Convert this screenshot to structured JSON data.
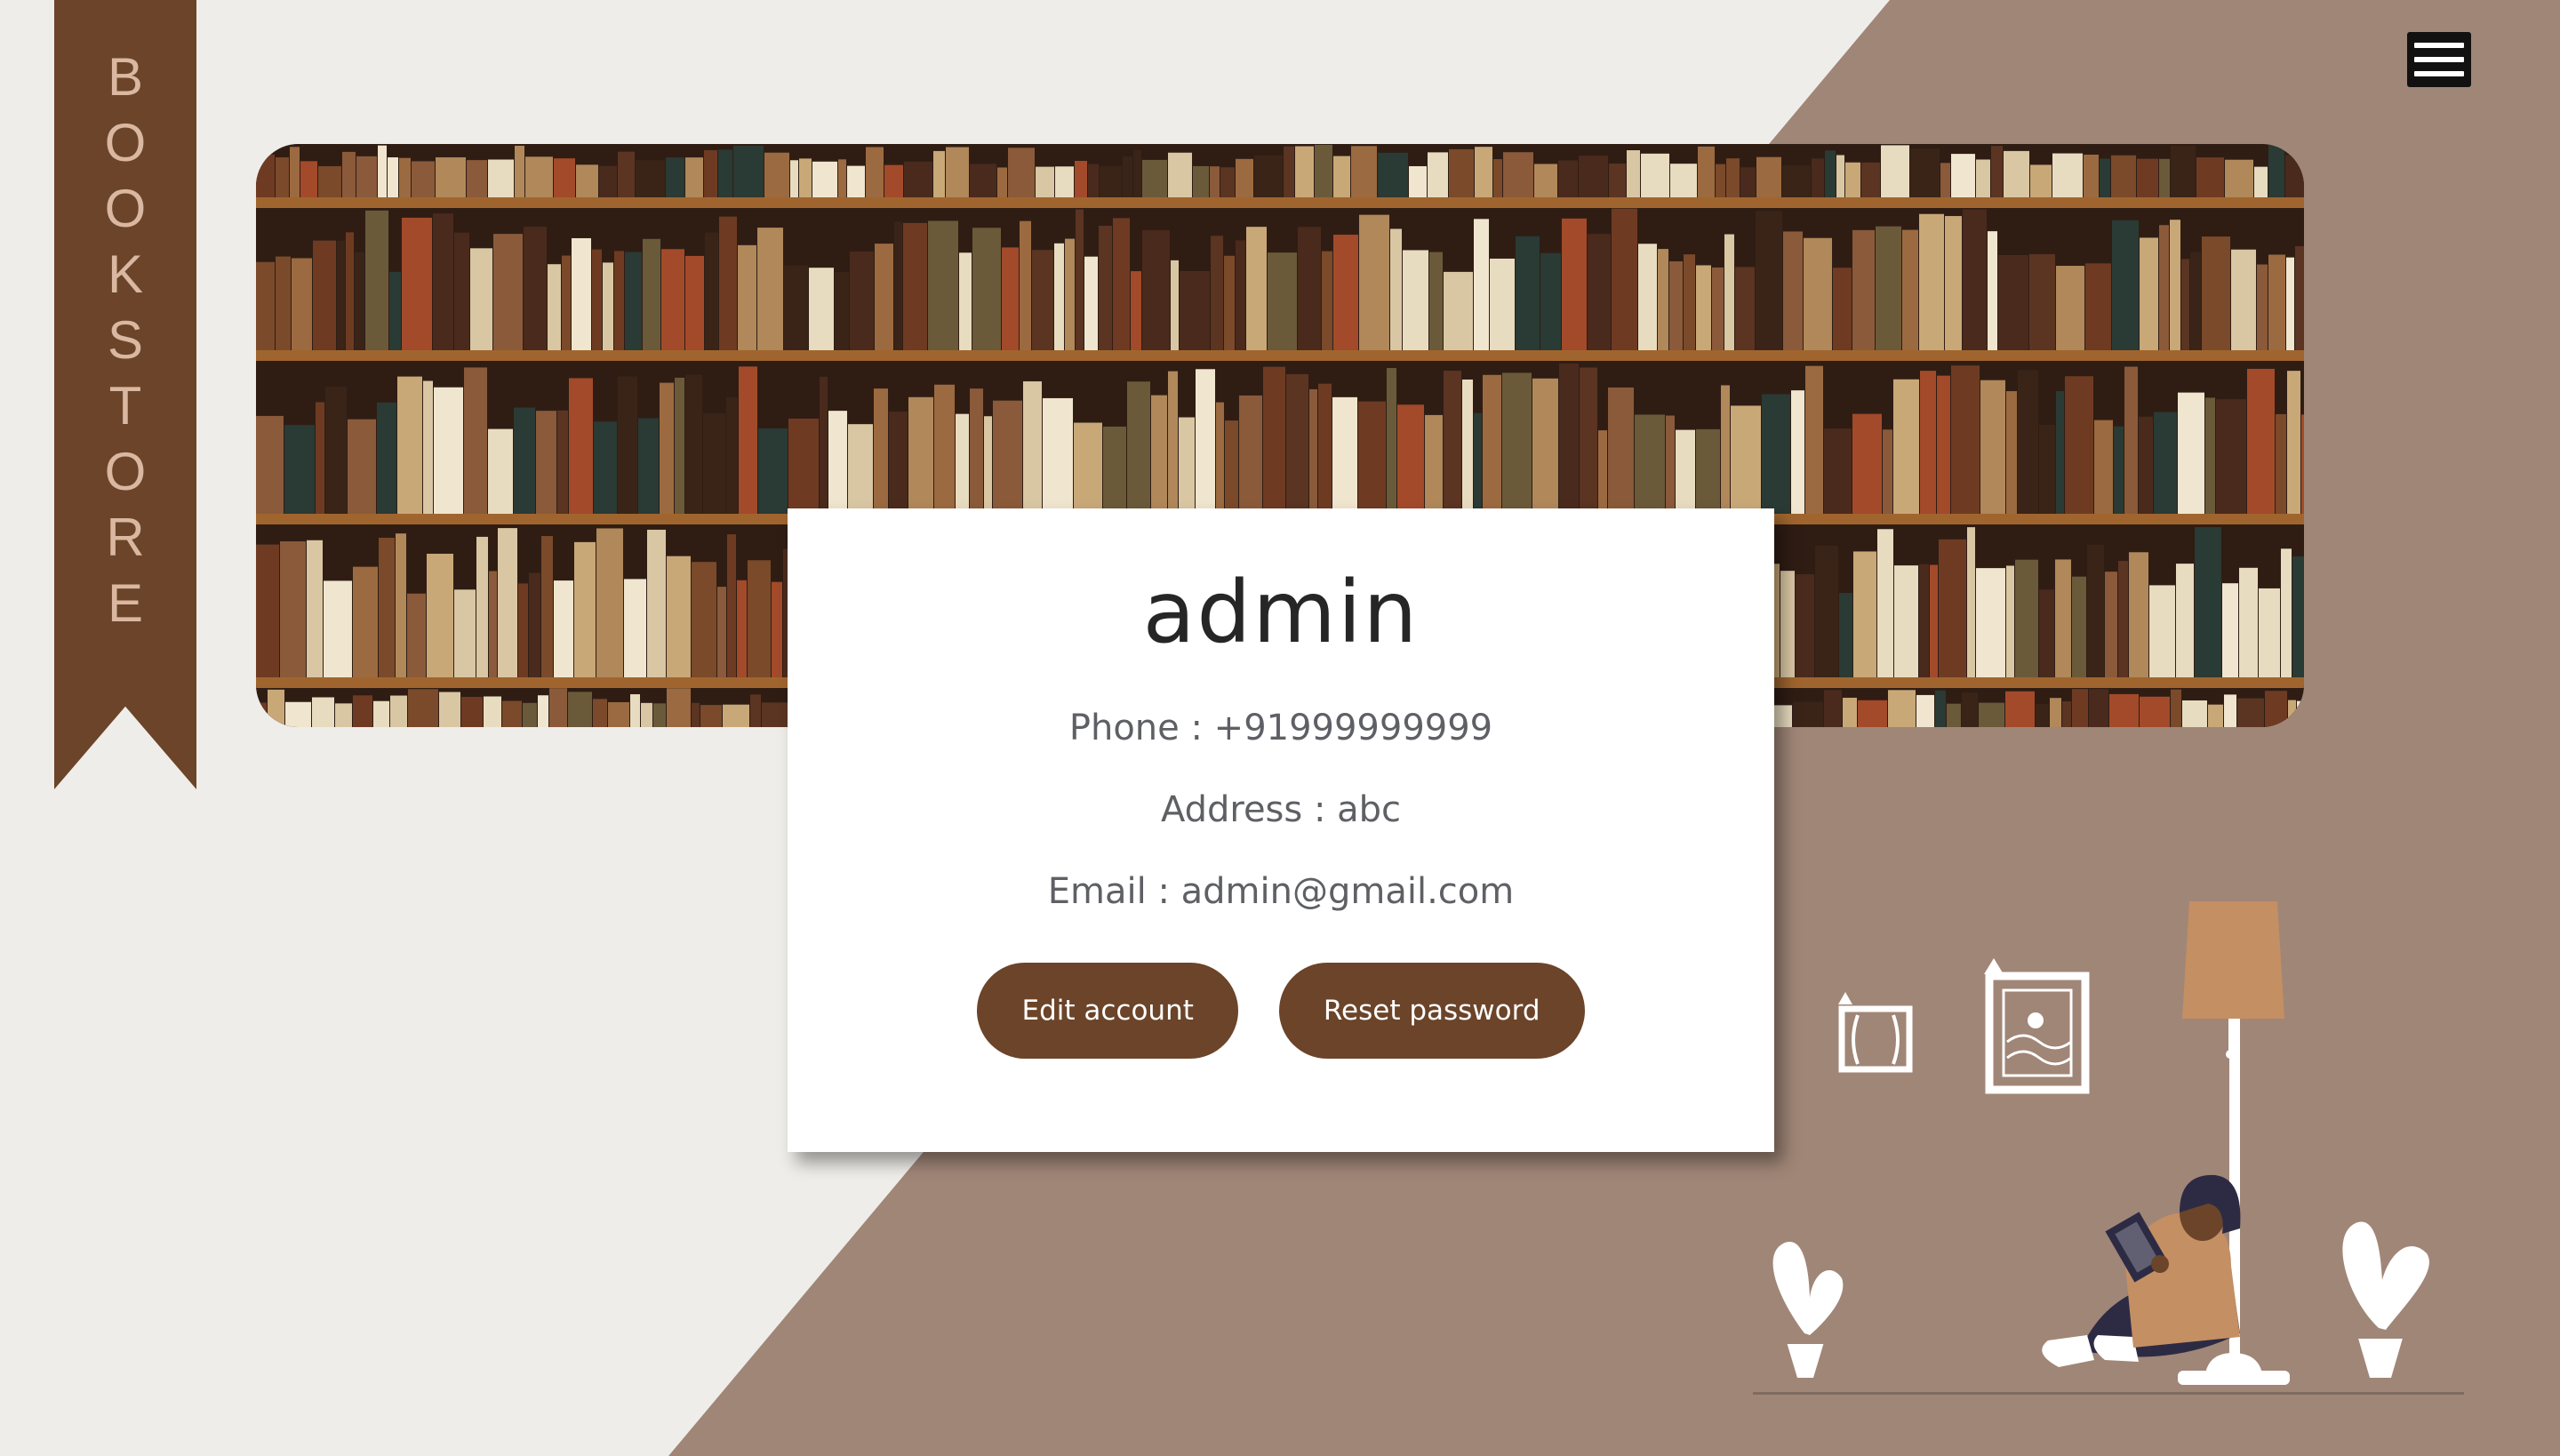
{
  "brand": {
    "letters": [
      "B",
      "O",
      "O",
      "K",
      "S",
      "T",
      "O",
      "R",
      "E"
    ]
  },
  "menu": {
    "icon": "hamburger-menu-icon"
  },
  "profile": {
    "name": "admin",
    "phone": "Phone : +91999999999",
    "address": "Address : abc",
    "email": "Email : admin@gmail.com"
  },
  "actions": {
    "edit_label": "Edit account",
    "reset_label": "Reset password"
  },
  "colors": {
    "accent": "#6b4429",
    "background_light": "#efede9",
    "background_brown": "#a08677",
    "lamp_shade": "#c48f63"
  }
}
